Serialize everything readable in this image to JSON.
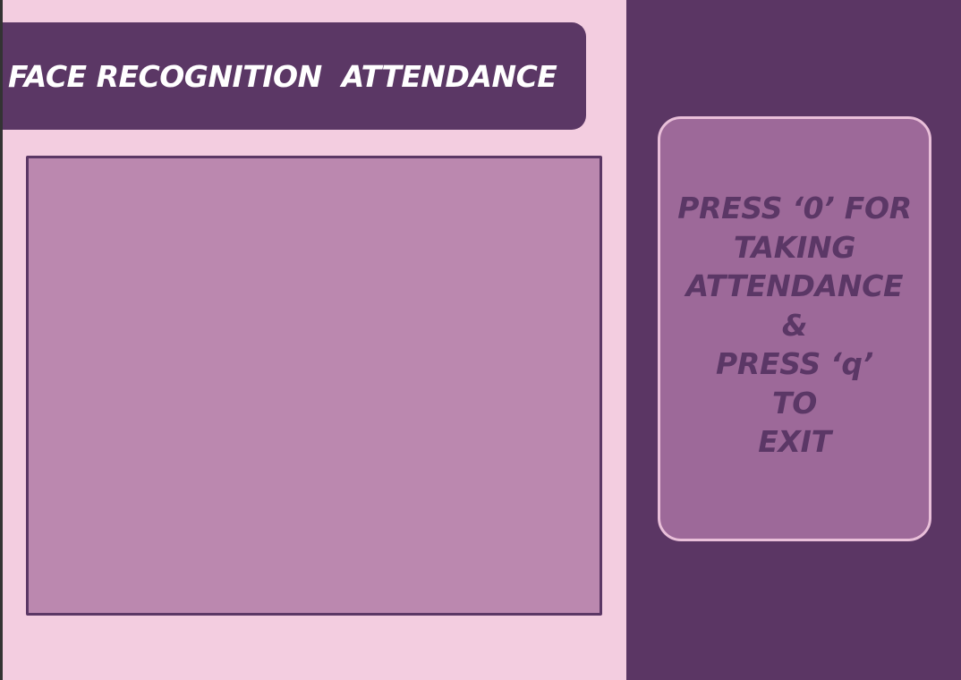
{
  "app": {
    "title": "FACE RECOGNITION  ATTENDANCE"
  },
  "instructions": {
    "lines": [
      "PRESS ‘0’ FOR",
      "TAKING",
      "ATTENDANCE",
      "&",
      "PRESS ‘q’",
      "TO",
      "EXIT"
    ]
  },
  "colors": {
    "page_background": "#f3cde0",
    "title_banner": "#5b3765",
    "camera_frame_fill": "#bb88af",
    "right_panel": "#5b3664",
    "instruction_card": "#9d6999",
    "instruction_card_border": "#e9bfd9",
    "instruction_text": "#5b3766",
    "title_text": "#ffffff"
  }
}
